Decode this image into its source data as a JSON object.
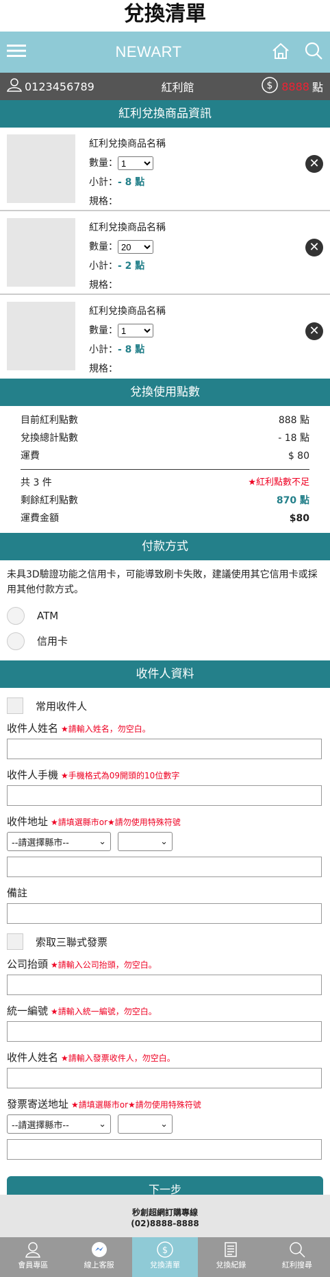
{
  "page_title": "兌換清單",
  "header": {
    "logo": "NEWART",
    "menu_icon": "hamburger-icon",
    "home_icon": "home-icon",
    "search_icon": "search-icon"
  },
  "userbar": {
    "member_id": "0123456789",
    "shop": "紅利館",
    "points": "8888",
    "points_unit": "點"
  },
  "products_section": {
    "title": "紅利兌換商品資訊"
  },
  "items": [
    {
      "name": "紅利兌換商品名稱",
      "qty_label": "數量：",
      "qty": "1",
      "subtotal_label": "小計：",
      "subtotal": "- 8 點",
      "spec_label": "規格："
    },
    {
      "name": "紅利兌換商品名稱",
      "qty_label": "數量：",
      "qty": "20",
      "subtotal_label": "小計：",
      "subtotal": "- 2 點",
      "spec_label": "規格："
    },
    {
      "name": "紅利兌換商品名稱",
      "qty_label": "數量：",
      "qty": "1",
      "subtotal_label": "小計：",
      "subtotal": "- 8 點",
      "spec_label": "規格："
    }
  ],
  "points_section": {
    "title": "兌換使用點數",
    "current_label": "目前紅利點數",
    "current_value": "888 點",
    "total_label": "兌換總計點數",
    "total_value": "- 18 點",
    "shipping_label": "運費",
    "shipping_value": "$ 80",
    "count_label": "共 3 件",
    "warning": "★紅利點數不足",
    "remain_label": "剩餘紅利點數",
    "remain_value": "870 點",
    "fee_label": "運費金額",
    "fee_value": "$80"
  },
  "payment": {
    "title": "付款方式",
    "notice": "未具3D驗證功能之信用卡，可能導致刷卡失敗，建議使用其它信用卡或採用其他付款方式。",
    "options": [
      "ATM",
      "信用卡"
    ]
  },
  "recipient": {
    "title": "收件人資料",
    "common_label": "常用收件人",
    "name_label": "收件人姓名",
    "name_hint": "★請輸入姓名，勿空白。",
    "phone_label": "收件人手機",
    "phone_hint": "★手機格式為09開頭的10位數字",
    "address_label": "收件地址",
    "address_hint": "★請填選縣市or★請勿使用特殊符號",
    "city_placeholder": "--請選擇縣市--",
    "note_label": "備註",
    "invoice_label": "索取三聯式發票",
    "company_label": "公司抬頭",
    "company_hint": "★請輸入公司抬頭，勿空白。",
    "taxid_label": "統一編號",
    "taxid_hint": "★請輸入統一編號，勿空白。",
    "inv_name_label": "收件人姓名",
    "inv_name_hint": "★請輸入發票收件人，勿空白。",
    "inv_addr_label": "發票寄送地址",
    "inv_addr_hint": "★請填選縣市or★請勿使用特殊符號"
  },
  "next_button": "下一步",
  "footer": {
    "line1": "秒創超網訂購專線",
    "line2": "(02)8888-8888"
  },
  "bottom_nav": [
    {
      "label": "會員專區",
      "icon": "user-icon"
    },
    {
      "label": "線上客服",
      "icon": "messenger-icon"
    },
    {
      "label": "兌換清單",
      "icon": "dollar-icon",
      "active": true
    },
    {
      "label": "兌換紀錄",
      "icon": "document-icon"
    },
    {
      "label": "紅利搜尋",
      "icon": "search-icon"
    }
  ]
}
